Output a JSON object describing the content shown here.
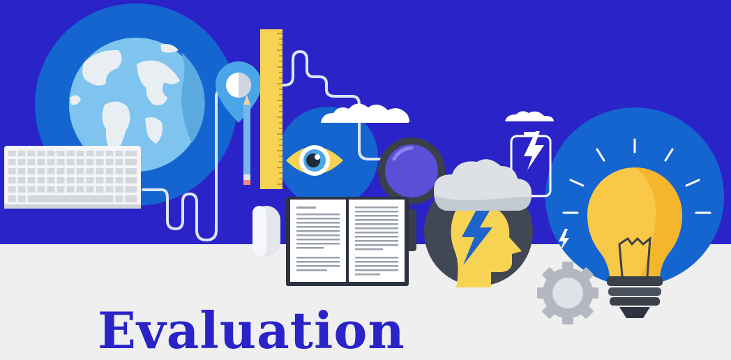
{
  "heading": "Evaluation",
  "colors": {
    "band": "#2a23c8",
    "lower_bg": "#efefef",
    "heading": "#2a23c8",
    "accent_circle": "#1565d0",
    "bulb": "#f9c846",
    "ruler": "#f7d354"
  },
  "icons": [
    "globe-icon",
    "keyboard-icon",
    "location-pin-icon",
    "pencil-icon",
    "ruler-icon",
    "cloud-icon",
    "eye-icon",
    "magnifier-icon",
    "book-icon",
    "mouse-icon",
    "thinking-head-icon",
    "lightning-icon",
    "battery-icon",
    "light-bulb-icon",
    "gear-icon"
  ]
}
